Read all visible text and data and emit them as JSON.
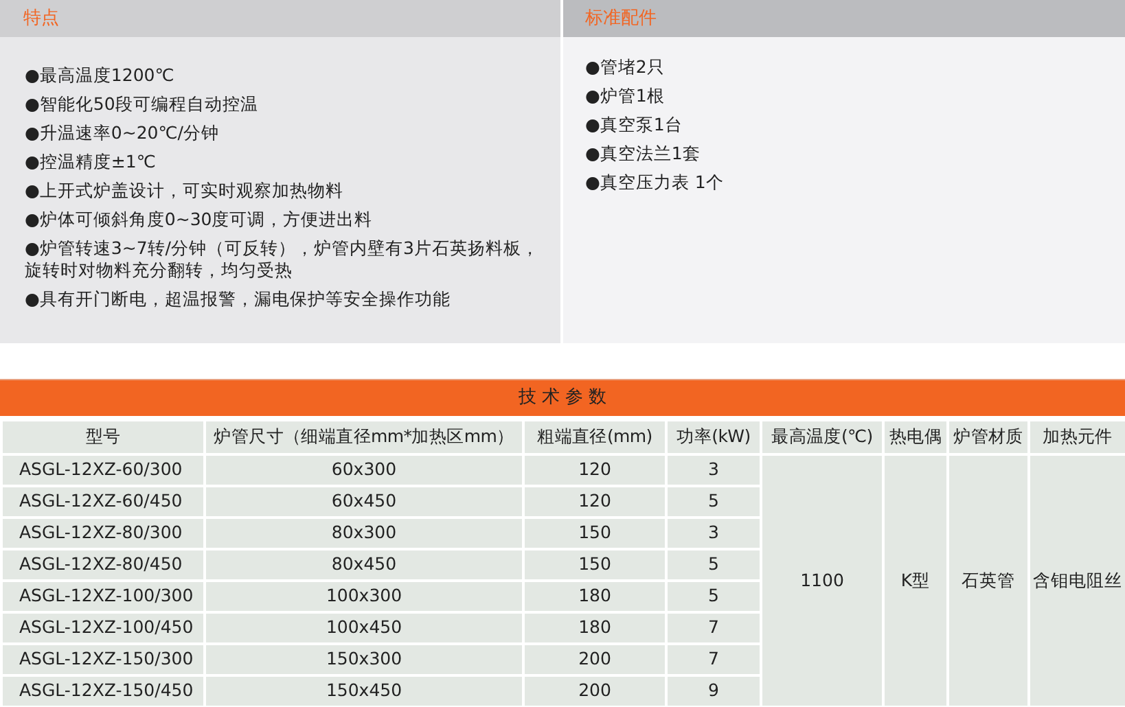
{
  "features": {
    "title": "特点",
    "items": [
      "●最高温度1200℃",
      "●智能化50段可编程自动控温",
      "●升温速率0~20℃/分钟",
      "●控温精度±1℃",
      "●上开式炉盖设计，可实时观察加热物料",
      "●炉体可倾斜角度0~30度可调，方便进出料",
      "●炉管转速3~7转/分钟（可反转），炉管内壁有3片石英扬料板，旋转时对物料充分翻转，均匀受热",
      "●具有开门断电，超温报警，漏电保护等安全操作功能"
    ]
  },
  "accessories": {
    "title": "标准配件",
    "items": [
      "●管堵2只",
      "●炉管1根",
      "●真空泵1台",
      "●真空法兰1套",
      "●真空压力表 1个"
    ]
  },
  "specs": {
    "title": "技 术 参 数",
    "columns": [
      "型号",
      "炉管尺寸（细端直径mm*加热区mm）",
      "粗端直径(mm)",
      "功率(kW)",
      "最高温度(℃)",
      "热电偶",
      "炉管材质",
      "加热元件"
    ],
    "rows": [
      [
        "ASGL-12XZ-60/300",
        "60x300",
        "120",
        "3"
      ],
      [
        "ASGL-12XZ-60/450",
        "60x450",
        "120",
        "5"
      ],
      [
        "ASGL-12XZ-80/300",
        "80x300",
        "150",
        "3"
      ],
      [
        "ASGL-12XZ-80/450",
        "80x450",
        "150",
        "5"
      ],
      [
        "ASGL-12XZ-100/300",
        "100x300",
        "180",
        "5"
      ],
      [
        "ASGL-12XZ-100/450",
        "100x450",
        "180",
        "7"
      ],
      [
        "ASGL-12XZ-150/300",
        "150x300",
        "200",
        "7"
      ],
      [
        "ASGL-12XZ-150/450",
        "150x450",
        "200",
        "9"
      ]
    ],
    "shared": [
      "1100",
      "K型",
      "石英管",
      "含钼电阻丝"
    ]
  }
}
